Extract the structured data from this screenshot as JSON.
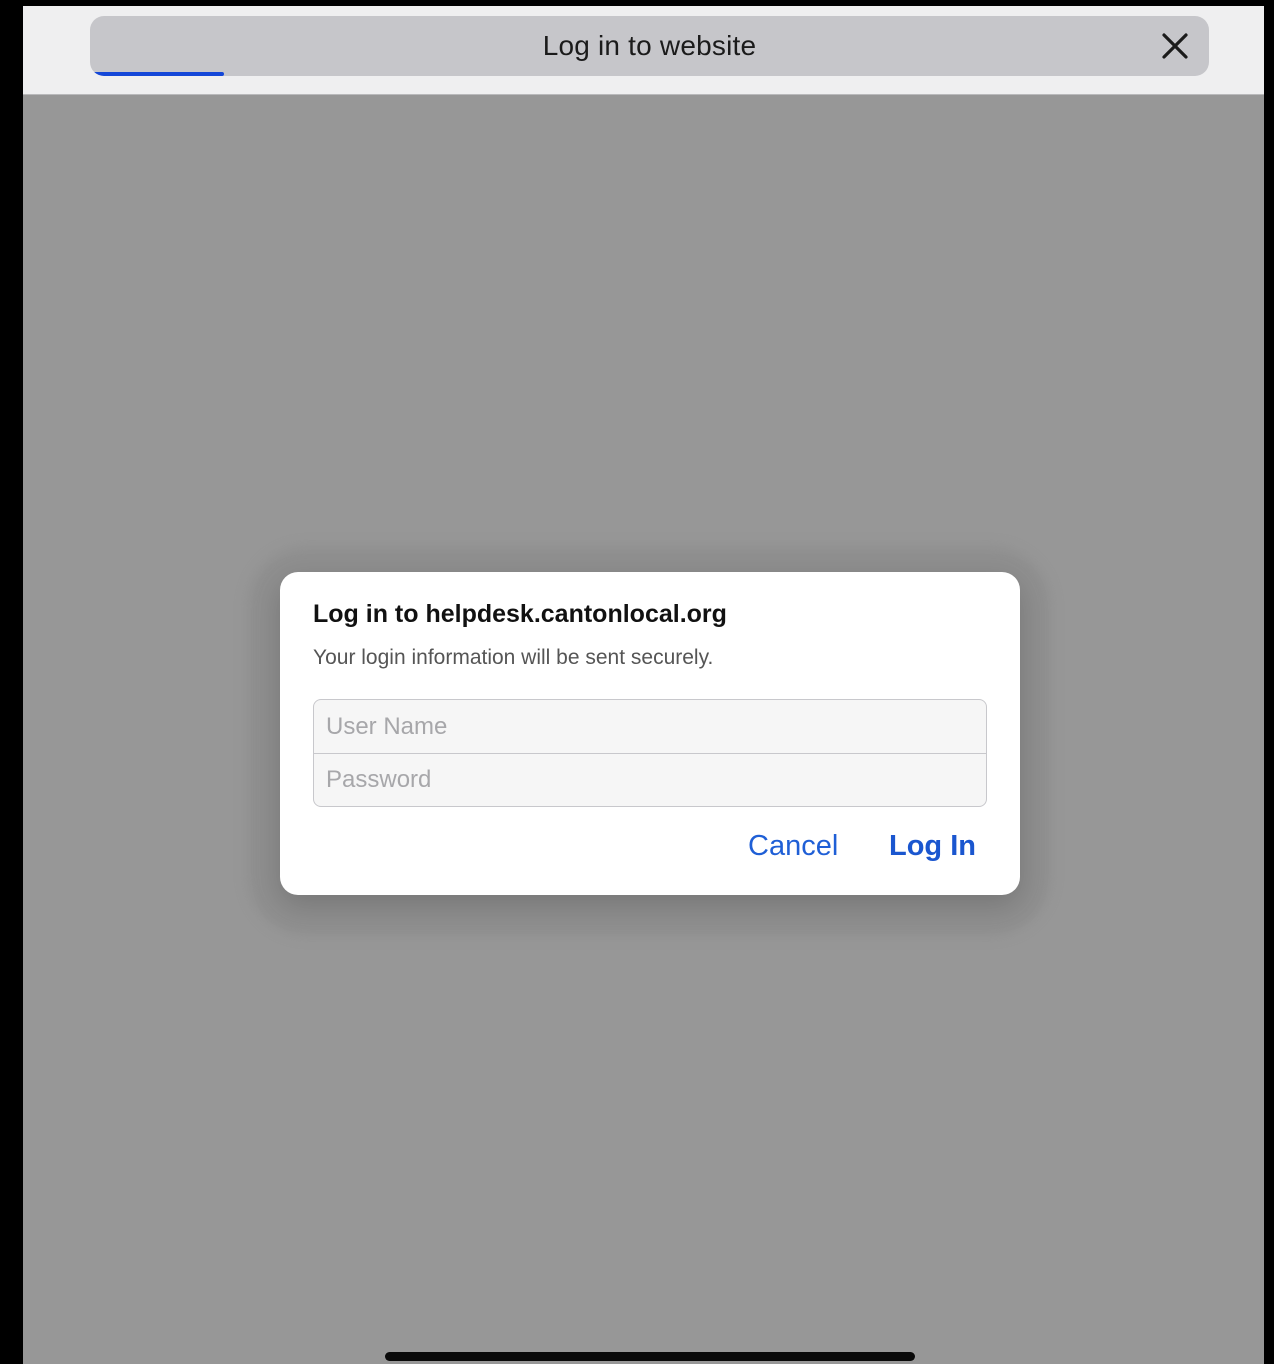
{
  "header": {
    "title": "Log in to website",
    "close_icon": "close-icon",
    "load_progress": 0.12,
    "progress_color": "#1447d8"
  },
  "dialog": {
    "title": "Log in to helpdesk.cantonlocal.org",
    "subtitle": "Your login information will be sent securely.",
    "username": {
      "placeholder": "User Name",
      "value": ""
    },
    "password": {
      "placeholder": "Password",
      "value": ""
    },
    "cancel_label": "Cancel",
    "login_label": "Log In",
    "accent_color": "#1f5fd6"
  }
}
